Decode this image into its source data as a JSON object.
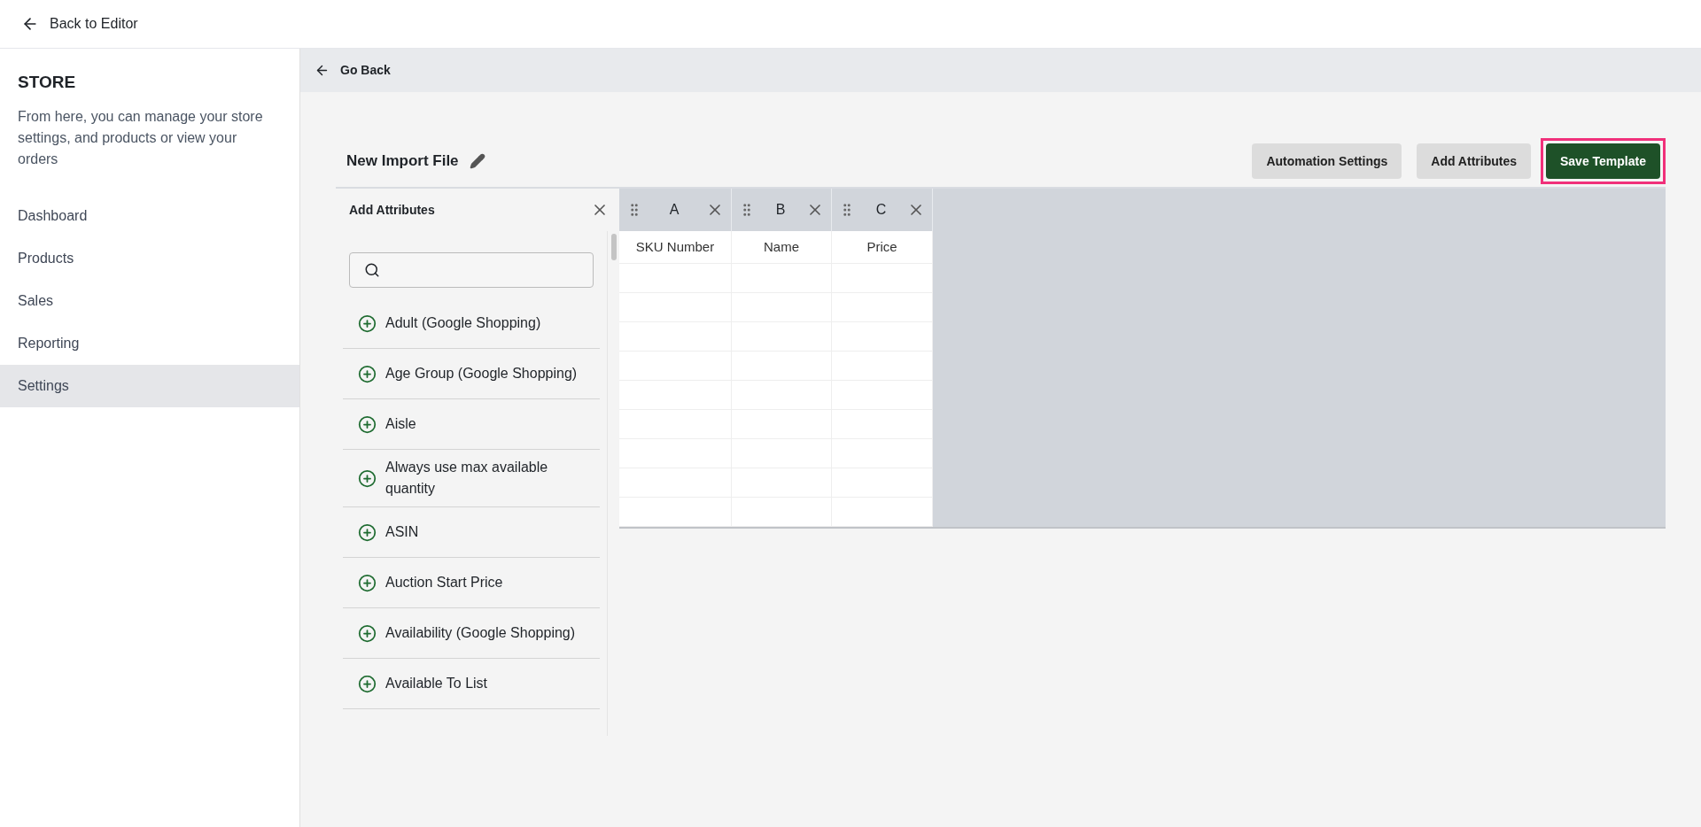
{
  "top_bar": {
    "back_label": "Back to Editor"
  },
  "sidebar": {
    "title": "STORE",
    "description": "From here, you can manage your store settings, and products or view your orders",
    "items": [
      {
        "label": "Dashboard",
        "selected": false
      },
      {
        "label": "Products",
        "selected": false
      },
      {
        "label": "Sales",
        "selected": false
      },
      {
        "label": "Reporting",
        "selected": false
      },
      {
        "label": "Settings",
        "selected": true
      }
    ]
  },
  "sub_bar": {
    "back_label": "Go Back"
  },
  "file_title": "New Import File",
  "buttons": [
    {
      "label": "Automation Settings",
      "kind": "secondary",
      "highlighted": false
    },
    {
      "label": "Add Attributes",
      "kind": "secondary",
      "highlighted": false
    },
    {
      "label": "Save Template",
      "kind": "primary",
      "highlighted": true
    }
  ],
  "attributes_panel": {
    "title": "Add Attributes",
    "items": [
      "Adult (Google Shopping)",
      "Age Group (Google Shopping)",
      "Aisle",
      "Always use max available quantity",
      "ASIN",
      "Auction Start Price",
      "Availability (Google Shopping)",
      "Available To List"
    ]
  },
  "table": {
    "columns": [
      {
        "letter": "A",
        "heading": "SKU Number"
      },
      {
        "letter": "B",
        "heading": "Name"
      },
      {
        "letter": "C",
        "heading": "Price"
      }
    ]
  }
}
